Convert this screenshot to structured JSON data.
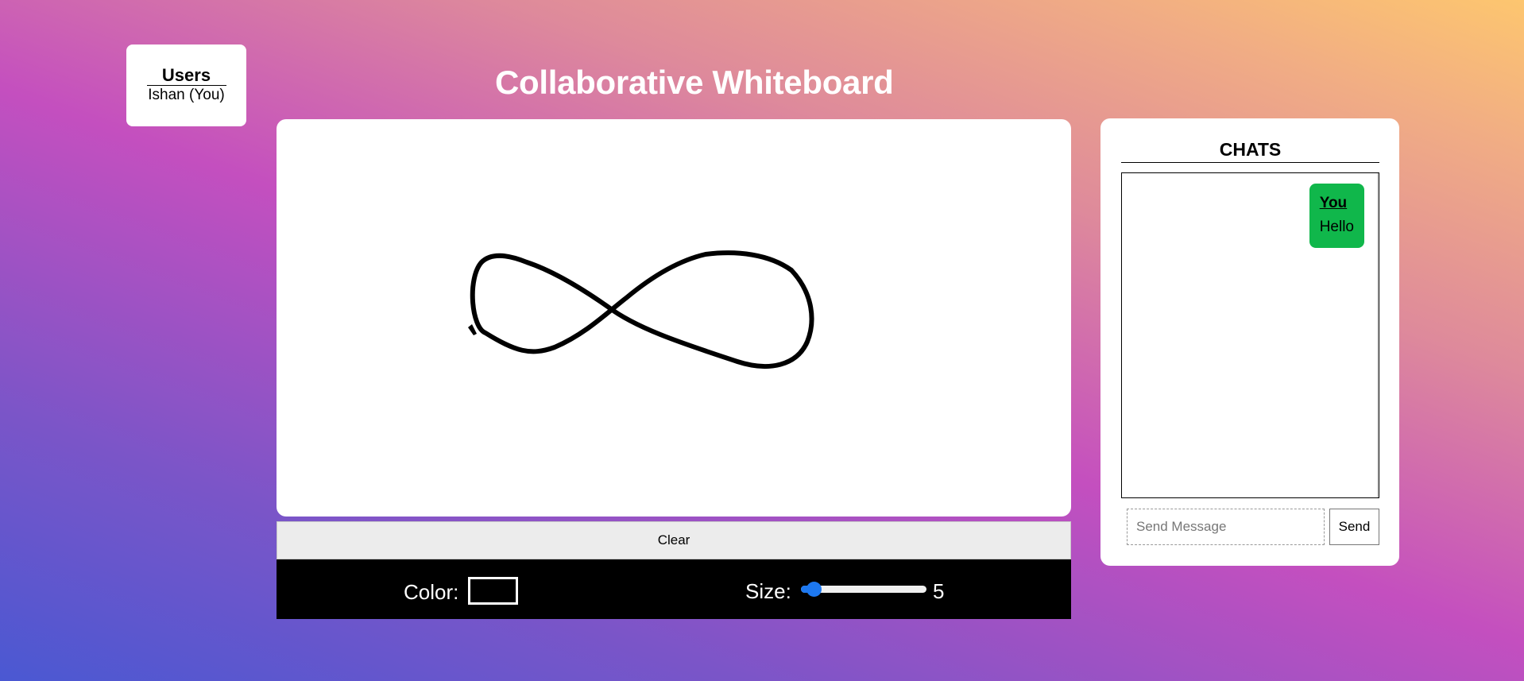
{
  "users": {
    "title": "Users",
    "list": [
      "Ishan (You)"
    ]
  },
  "header": {
    "title": "Collaborative Whiteboard"
  },
  "whiteboard": {
    "stroke_color": "#000000",
    "clear_label": "Clear"
  },
  "toolbar": {
    "color_label": "Color:",
    "color_value": "#000000",
    "size_label": "Size:",
    "size_value": "5",
    "size_fraction": 0.05
  },
  "chat": {
    "title": "CHATS",
    "messages": [
      {
        "sender": "You",
        "text": "Hello",
        "bubble_color": "#10b74b"
      }
    ],
    "input_placeholder": "Send Message",
    "send_label": "Send"
  },
  "colors": {
    "accent": "#1d78f0",
    "chat_bubble": "#10b74b",
    "toolbar_bg": "#000000"
  }
}
